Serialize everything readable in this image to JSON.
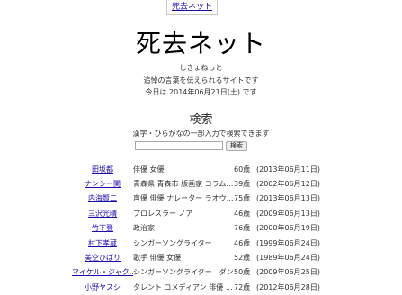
{
  "nav": {
    "link_label": "死去ネット"
  },
  "header": {
    "logo": "死去ネット",
    "reading": "しきょねっと",
    "tagline": "追悼の言葉を伝えられるサイトです",
    "today": "今日は 2014年06月21日(土) です"
  },
  "search": {
    "heading": "検索",
    "description": "漢字・ひらがなの一部入力で検索できます",
    "input_value": "",
    "button_label": "検索"
  },
  "entries": [
    {
      "name": "田坂都",
      "occupation": "俳優 女優",
      "age": "60歳",
      "date": "(2013年06月11日)"
    },
    {
      "name": "ナンシー関",
      "occupation": "青森県 青森市 版画家 コラム…",
      "age": "39歳",
      "date": "(2002年06月12日)"
    },
    {
      "name": "内海賢二",
      "occupation": "声優 俳優 ナレーター ラオウ…",
      "age": "75歳",
      "date": "(2013年06月13日)"
    },
    {
      "name": "三沢光晴",
      "occupation": "プロレスラー ノア",
      "age": "46歳",
      "date": "(2009年06月13日)"
    },
    {
      "name": "竹下登",
      "occupation": "政治家",
      "age": "76歳",
      "date": "(2000年06月19日)"
    },
    {
      "name": "村下孝蔵",
      "occupation": "シンガーソングライター",
      "age": "46歳",
      "date": "(1999年06月24日)"
    },
    {
      "name": "美空ひばり",
      "occupation": "歌手 俳優 女優",
      "age": "52歳",
      "date": "(1989年06月24日)"
    },
    {
      "name": "マイケル・ジャク…",
      "occupation": "シンガーソングライター　ダン…",
      "age": "50歳",
      "date": "(2009年06月25日)"
    },
    {
      "name": "小野ヤスシ",
      "occupation": "タレント コメディアン 俳優 …",
      "age": "72歳",
      "date": "(2012年06月28日)"
    }
  ]
}
